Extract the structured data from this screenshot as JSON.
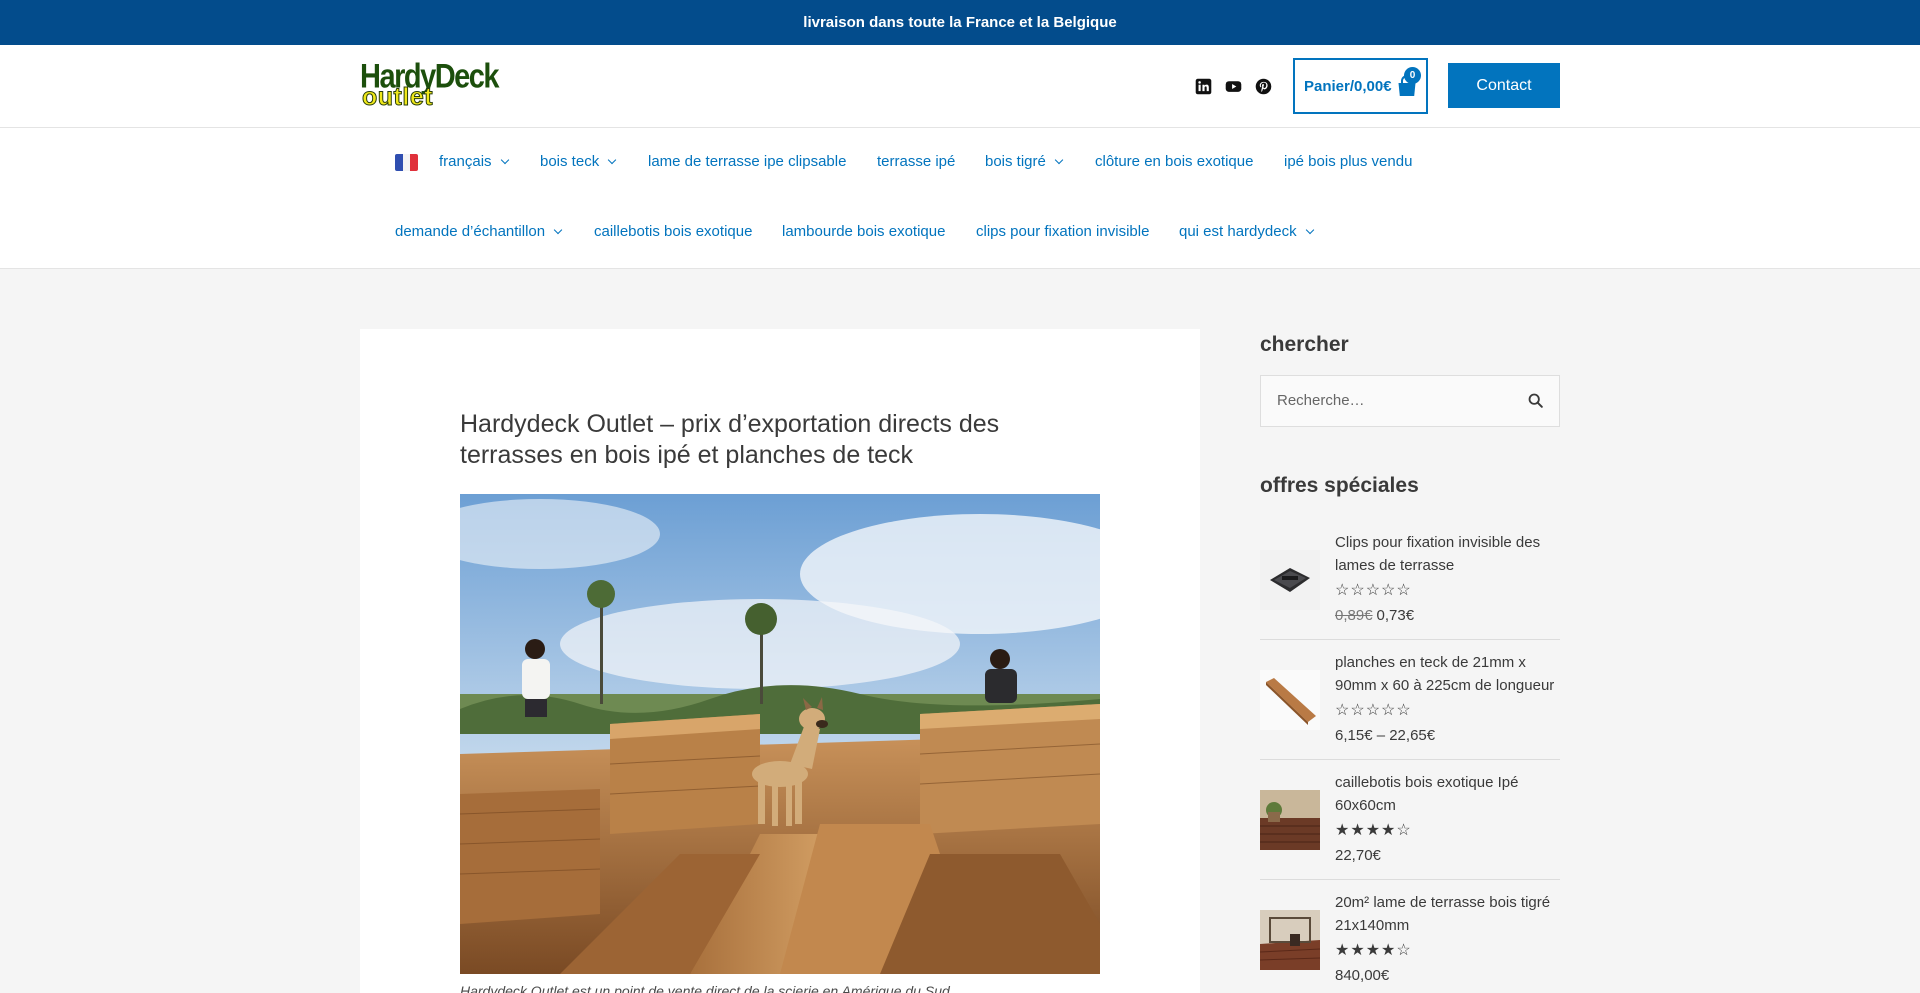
{
  "topbar": {
    "text": "livraison dans toute la France et la Belgique"
  },
  "header": {
    "logo_line1": "HardyDeck",
    "logo_line2": "outlet",
    "social": [
      "linkedin-icon",
      "youtube-icon",
      "pinterest-icon"
    ],
    "cart_label": "Panier/0,00€",
    "cart_count": "0",
    "contact_label": "Contact"
  },
  "nav": {
    "row1": [
      {
        "label": "français",
        "dropdown": true
      },
      {
        "label": "bois teck",
        "dropdown": true
      },
      {
        "label": "lame de terrasse ipe clipsable",
        "dropdown": false
      },
      {
        "label": "terrasse ipé",
        "dropdown": false
      },
      {
        "label": "bois tigré",
        "dropdown": true
      },
      {
        "label": "clôture en bois exotique",
        "dropdown": false
      },
      {
        "label": "ipé bois plus vendu",
        "dropdown": false
      }
    ],
    "row2": [
      {
        "label": "demande d’échantillon",
        "dropdown": true
      },
      {
        "label": "caillebotis bois exotique",
        "dropdown": false
      },
      {
        "label": "lambourde bois exotique",
        "dropdown": false
      },
      {
        "label": "clips pour fixation invisible",
        "dropdown": false
      },
      {
        "label": "qui est hardydeck",
        "dropdown": true
      }
    ]
  },
  "article": {
    "title": "Hardydeck Outlet – prix d’exportation directs des terrasses en bois ipé et planches de teck",
    "caption": "Hardydeck Outlet est un point de vente direct de la scierie en Amérique du Sud"
  },
  "sidebar": {
    "search_title": "chercher",
    "search_placeholder": "Recherche…",
    "offers_title": "offres spéciales",
    "products": [
      {
        "name": "Clips pour fixation invisible des lames de terrasse",
        "rating": 0,
        "old_price": "0,89€",
        "price": "0,73€"
      },
      {
        "name": "planches en teck de 21mm x 90mm x 60 à 225cm de longueur",
        "rating": 0,
        "old_price": "",
        "price": "6,15€  –  22,65€"
      },
      {
        "name": "caillebotis bois exotique Ipé 60x60cm",
        "rating": 4,
        "old_price": "",
        "price": "22,70€"
      },
      {
        "name": "20m² lame de terrasse bois tigré 21x140mm",
        "rating": 4,
        "old_price": "",
        "price": "840,00€"
      }
    ]
  },
  "colors": {
    "brand_blue": "#034c8c",
    "link_blue": "#0274be"
  }
}
